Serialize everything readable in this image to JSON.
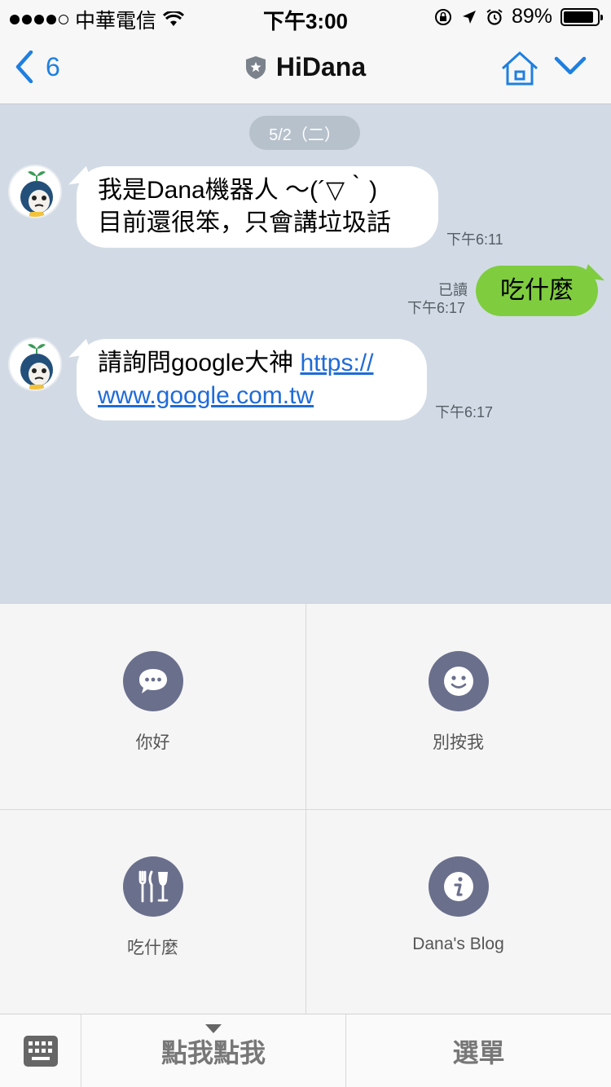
{
  "status_bar": {
    "carrier": "中華電信",
    "time": "下午3:00",
    "battery": "89%",
    "battery_level": 0.89,
    "icons": [
      "signal-dots",
      "wifi-icon",
      "orientation-lock-icon",
      "location-arrow-icon",
      "alarm-icon",
      "battery-icon"
    ]
  },
  "nav": {
    "back_count": "6",
    "title": "HiDana",
    "icons": [
      "chevron-left-icon",
      "official-shield-icon",
      "home-icon",
      "chevron-down-icon"
    ],
    "accent_color": "#1f7fe0"
  },
  "chat": {
    "date": "5/2（二）",
    "messages": [
      {
        "side": "left",
        "lines": [
          "我是Dana機器人 ～(´▽｀)",
          "目前還很笨，只會講垃圾話"
        ],
        "time": "下午6:11"
      },
      {
        "side": "right",
        "text": "吃什麼",
        "read": "已讀",
        "time": "下午6:17"
      },
      {
        "side": "left",
        "text_prefix": "請詢問google大神 ",
        "link_line1": "https://",
        "link_line2": "www.google.com.tw",
        "time": "下午6:17"
      }
    ],
    "background_color": "#d2dbe5",
    "bubble_color_self": "#7fcd3f"
  },
  "rich_menu": {
    "items": [
      {
        "label": "你好",
        "icon": "chat-bubble-icon"
      },
      {
        "label": "別按我",
        "icon": "smiley-icon"
      },
      {
        "label": "吃什麼",
        "icon": "fork-knife-glass-icon"
      },
      {
        "label": "Dana's Blog",
        "icon": "info-icon"
      }
    ],
    "icon_color": "#6a6f8c"
  },
  "bottom_bar": {
    "tap_label": "點我點我",
    "menu_label": "選單",
    "icons": [
      "keyboard-icon",
      "triangle-down-icon"
    ]
  }
}
